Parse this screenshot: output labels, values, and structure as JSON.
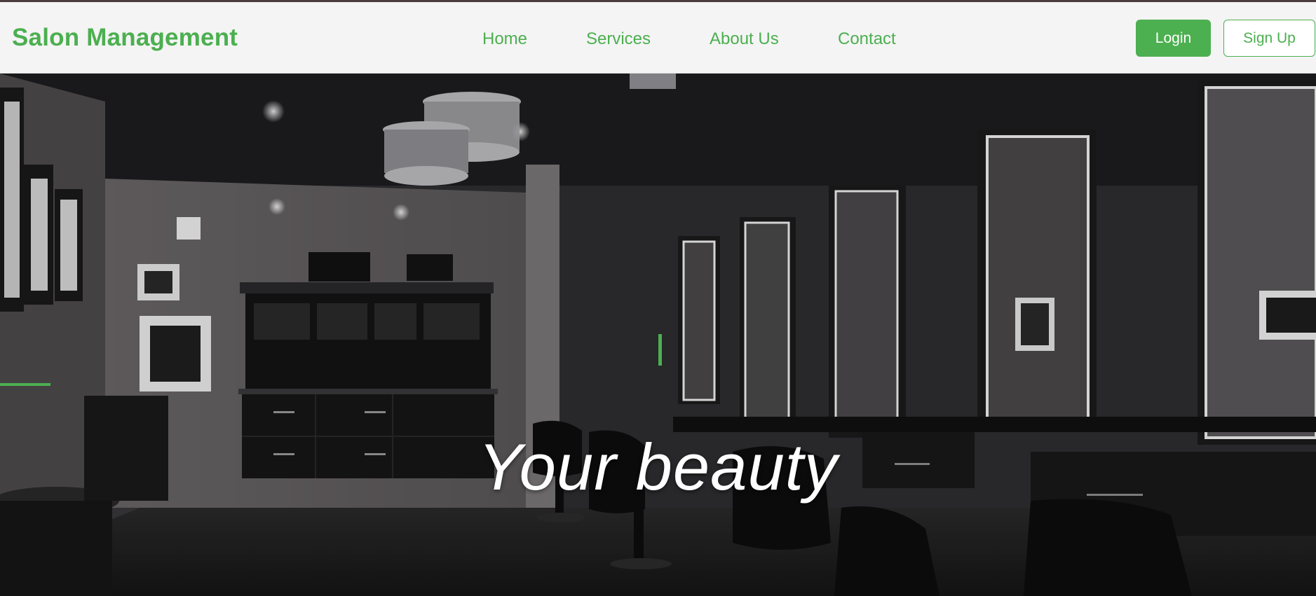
{
  "header": {
    "brand": "Salon Management",
    "nav": [
      "Home",
      "Services",
      "About Us",
      "Contact"
    ],
    "login_label": "Login",
    "signup_label": "Sign Up"
  },
  "hero": {
    "title": "Your beauty",
    "image": "salon-interior-photo"
  },
  "colors": {
    "accent": "#4caf50",
    "navbar_bg": "#f4f4f4",
    "hero_title": "#ffffff"
  }
}
